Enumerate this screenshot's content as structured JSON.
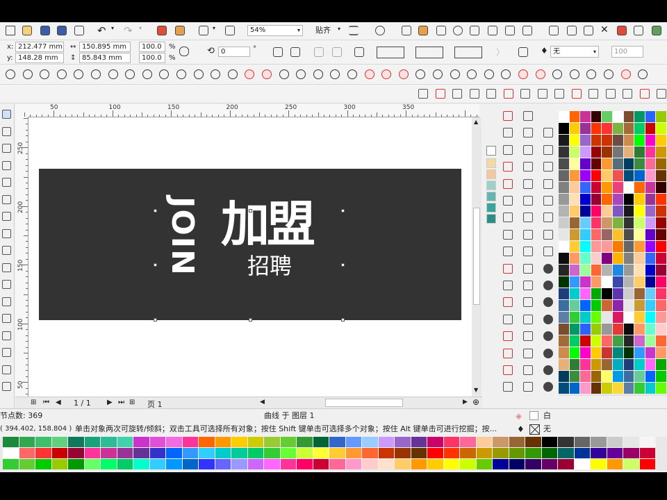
{
  "toolbar": {
    "zoom_value": "54%",
    "snap_label": "贴齐"
  },
  "property_bar": {
    "x_label": "x:",
    "x_value": "212.477 mm",
    "y_label": "y:",
    "y_value": "148.28 mm",
    "width_value": "150.895 mm",
    "height_value": "85.843 mm",
    "scale_x": "100.0",
    "scale_y": "100.0",
    "percent": "%",
    "rotation_value": "0",
    "degree": "°",
    "outline_value": "无",
    "opacity_value": "100"
  },
  "ruler": {
    "h_ticks": [
      "50",
      "100",
      "150",
      "200",
      "250",
      "300",
      "350"
    ],
    "v_ticks": [
      "250",
      "200",
      "150",
      "100",
      "50"
    ]
  },
  "canvas": {
    "logo_join": "JOIN",
    "logo_cn_big": "加盟",
    "logo_cn_small": "招聘"
  },
  "page_nav": {
    "page_count": "1 / 1",
    "page_tab": "页 1"
  },
  "status": {
    "node_count": "节点数: 369",
    "layer_info": "曲线 于 图层 1",
    "coords": "( 394.402, 158.804 )",
    "hint": "单击对象两次可旋转/倾斜；双击工具可选择所有对象；按住 Shift 键单击可选择多个对象；按住 Alt 键单击可进行挖掘；按...",
    "fill_label": "白",
    "outline_label": "无"
  },
  "colors": {
    "canvas_bg": "#ffffff",
    "design_bg": "#333333",
    "logo_color": "#ffffff"
  }
}
